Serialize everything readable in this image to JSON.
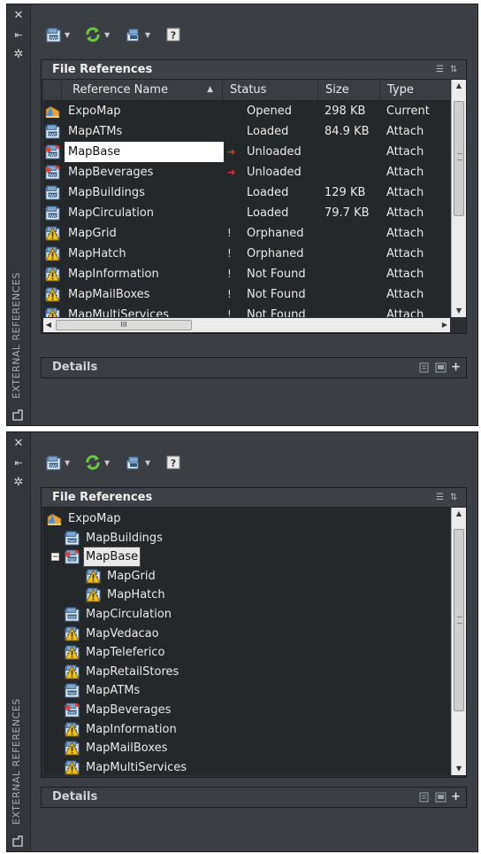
{
  "palette_title": "EXTERNAL REFERENCES",
  "panel_title": "File References",
  "details_title": "Details",
  "hscroll_grip": "III",
  "columns": [
    "Reference Name",
    "Status",
    "Size",
    "Type"
  ],
  "rows": [
    {
      "name": "ExpoMap",
      "icon": "map-host-icon",
      "flag": "",
      "status": "Opened",
      "size": "298 KB",
      "type": "Current"
    },
    {
      "name": "MapATMs",
      "icon": "dwg-file-icon",
      "flag": "",
      "status": "Loaded",
      "size": "84.9 KB",
      "type": "Attach"
    },
    {
      "name": "MapBase",
      "icon": "dwg-unloaded-icon",
      "flag": "unloaded-arrow-icon",
      "status": "Unloaded",
      "size": "",
      "type": "Attach",
      "selected": true
    },
    {
      "name": "MapBeverages",
      "icon": "dwg-unloaded-icon",
      "flag": "unloaded-arrow-icon",
      "status": "Unloaded",
      "size": "",
      "type": "Attach"
    },
    {
      "name": "MapBuildings",
      "icon": "dwg-file-icon",
      "flag": "",
      "status": "Loaded",
      "size": "129 KB",
      "type": "Attach"
    },
    {
      "name": "MapCirculation",
      "icon": "dwg-file-icon",
      "flag": "",
      "status": "Loaded",
      "size": "79.7 KB",
      "type": "Attach"
    },
    {
      "name": "MapGrid",
      "icon": "dwg-warning-icon",
      "flag": "exclamation-icon",
      "status": "Orphaned",
      "size": "",
      "type": "Attach"
    },
    {
      "name": "MapHatch",
      "icon": "dwg-warning-icon",
      "flag": "exclamation-icon",
      "status": "Orphaned",
      "size": "",
      "type": "Attach"
    },
    {
      "name": "MapInformation",
      "icon": "dwg-warning-icon",
      "flag": "exclamation-icon",
      "status": "Not Found",
      "size": "",
      "type": "Attach"
    },
    {
      "name": "MapMailBoxes",
      "icon": "dwg-warning-icon",
      "flag": "exclamation-icon",
      "status": "Not Found",
      "size": "",
      "type": "Attach"
    },
    {
      "name": "MapMultiServices",
      "icon": "dwg-warning-icon",
      "flag": "exclamation-icon",
      "status": "Not Found",
      "size": "",
      "type": "Attach"
    }
  ],
  "tree": [
    {
      "name": "ExpoMap",
      "icon": "map-host-icon",
      "level": 0
    },
    {
      "name": "MapBuildings",
      "icon": "dwg-file-icon",
      "level": 1
    },
    {
      "name": "MapBase",
      "icon": "dwg-unloaded-icon",
      "level": 1,
      "expanded": true,
      "selected": true
    },
    {
      "name": "MapGrid",
      "icon": "dwg-warning-icon",
      "level": 2
    },
    {
      "name": "MapHatch",
      "icon": "dwg-warning-icon",
      "level": 2
    },
    {
      "name": "MapCirculation",
      "icon": "dwg-file-icon",
      "level": 1
    },
    {
      "name": "MapVedacao",
      "icon": "dwg-warning-icon",
      "level": 1
    },
    {
      "name": "MapTeleferico",
      "icon": "dwg-warning-icon",
      "level": 1
    },
    {
      "name": "MapRetailStores",
      "icon": "dwg-warning-icon",
      "level": 1
    },
    {
      "name": "MapATMs",
      "icon": "dwg-file-icon",
      "level": 1
    },
    {
      "name": "MapBeverages",
      "icon": "dwg-unloaded-icon",
      "level": 1
    },
    {
      "name": "MapInformation",
      "icon": "dwg-warning-icon",
      "level": 1
    },
    {
      "name": "MapMailBoxes",
      "icon": "dwg-warning-icon",
      "level": 1
    },
    {
      "name": "MapMultiServices",
      "icon": "dwg-warning-icon",
      "level": 1
    }
  ],
  "colors": {
    "refresh": "#6cc644",
    "unloaded": "#e23a2a",
    "warning": "#f0c419",
    "selection": "#ffffff"
  }
}
